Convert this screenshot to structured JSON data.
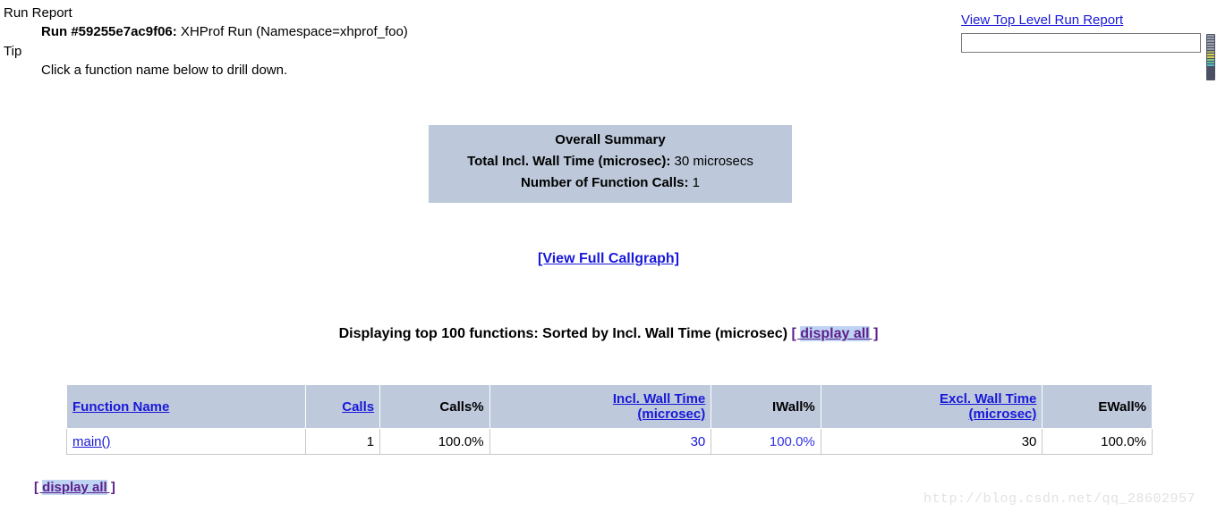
{
  "header": {
    "run_report_term": "Run Report",
    "run_label": "Run #59255e7ac9f06:",
    "run_description": " XHProf Run (Namespace=xhprof_foo)",
    "tip_term": "Tip",
    "tip_text": "Click a function name below to drill down."
  },
  "top_right": {
    "link_label": "View Top Level Run Report",
    "input_value": "",
    "input_placeholder": ""
  },
  "summary": {
    "title": "Overall Summary",
    "total_time_label": "Total Incl. Wall Time (microsec):",
    "total_time_value": " 30 microsecs",
    "num_calls_label": "Number of Function Calls:",
    "num_calls_value": " 1"
  },
  "callgraph": {
    "link_label": "[View Full Callgraph]"
  },
  "display_heading": {
    "text": "Displaying top 100 functions: Sorted by Incl. Wall Time (microsec) ",
    "bracket_open": "[ ",
    "display_all_label": "display all",
    "bracket_close": " ]"
  },
  "table": {
    "columns": [
      {
        "label": "Function Name",
        "link": true
      },
      {
        "label": "Calls",
        "link": true
      },
      {
        "label": "Calls%",
        "link": false
      },
      {
        "label": "Incl. Wall Time",
        "label2": "(microsec)",
        "link": true
      },
      {
        "label": "IWall%",
        "link": false
      },
      {
        "label": "Excl. Wall Time",
        "label2": "(microsec)",
        "link": true
      },
      {
        "label": "EWall%",
        "link": false
      }
    ],
    "rows": [
      {
        "function_name": "main()",
        "calls": "1",
        "calls_pct": "100.0%",
        "incl_wall_time": "30",
        "iwall_pct": "100.0%",
        "excl_wall_time": "30",
        "ewall_pct": "100.0%"
      }
    ]
  },
  "bottom": {
    "bracket_open": "[ ",
    "display_all_label": "display all",
    "bracket_close": " ]"
  },
  "watermark": {
    "text": "http://blog.csdn.net/qq_28602957"
  },
  "colors": {
    "link": "#1818d8",
    "visited_link": "#5c1f8c",
    "selection_highlight": "#bfd4f2",
    "summary_bg": "#bdc8da",
    "table_header_bg": "#bfc9dc",
    "scrollbar_thumb": "#4b5162"
  }
}
